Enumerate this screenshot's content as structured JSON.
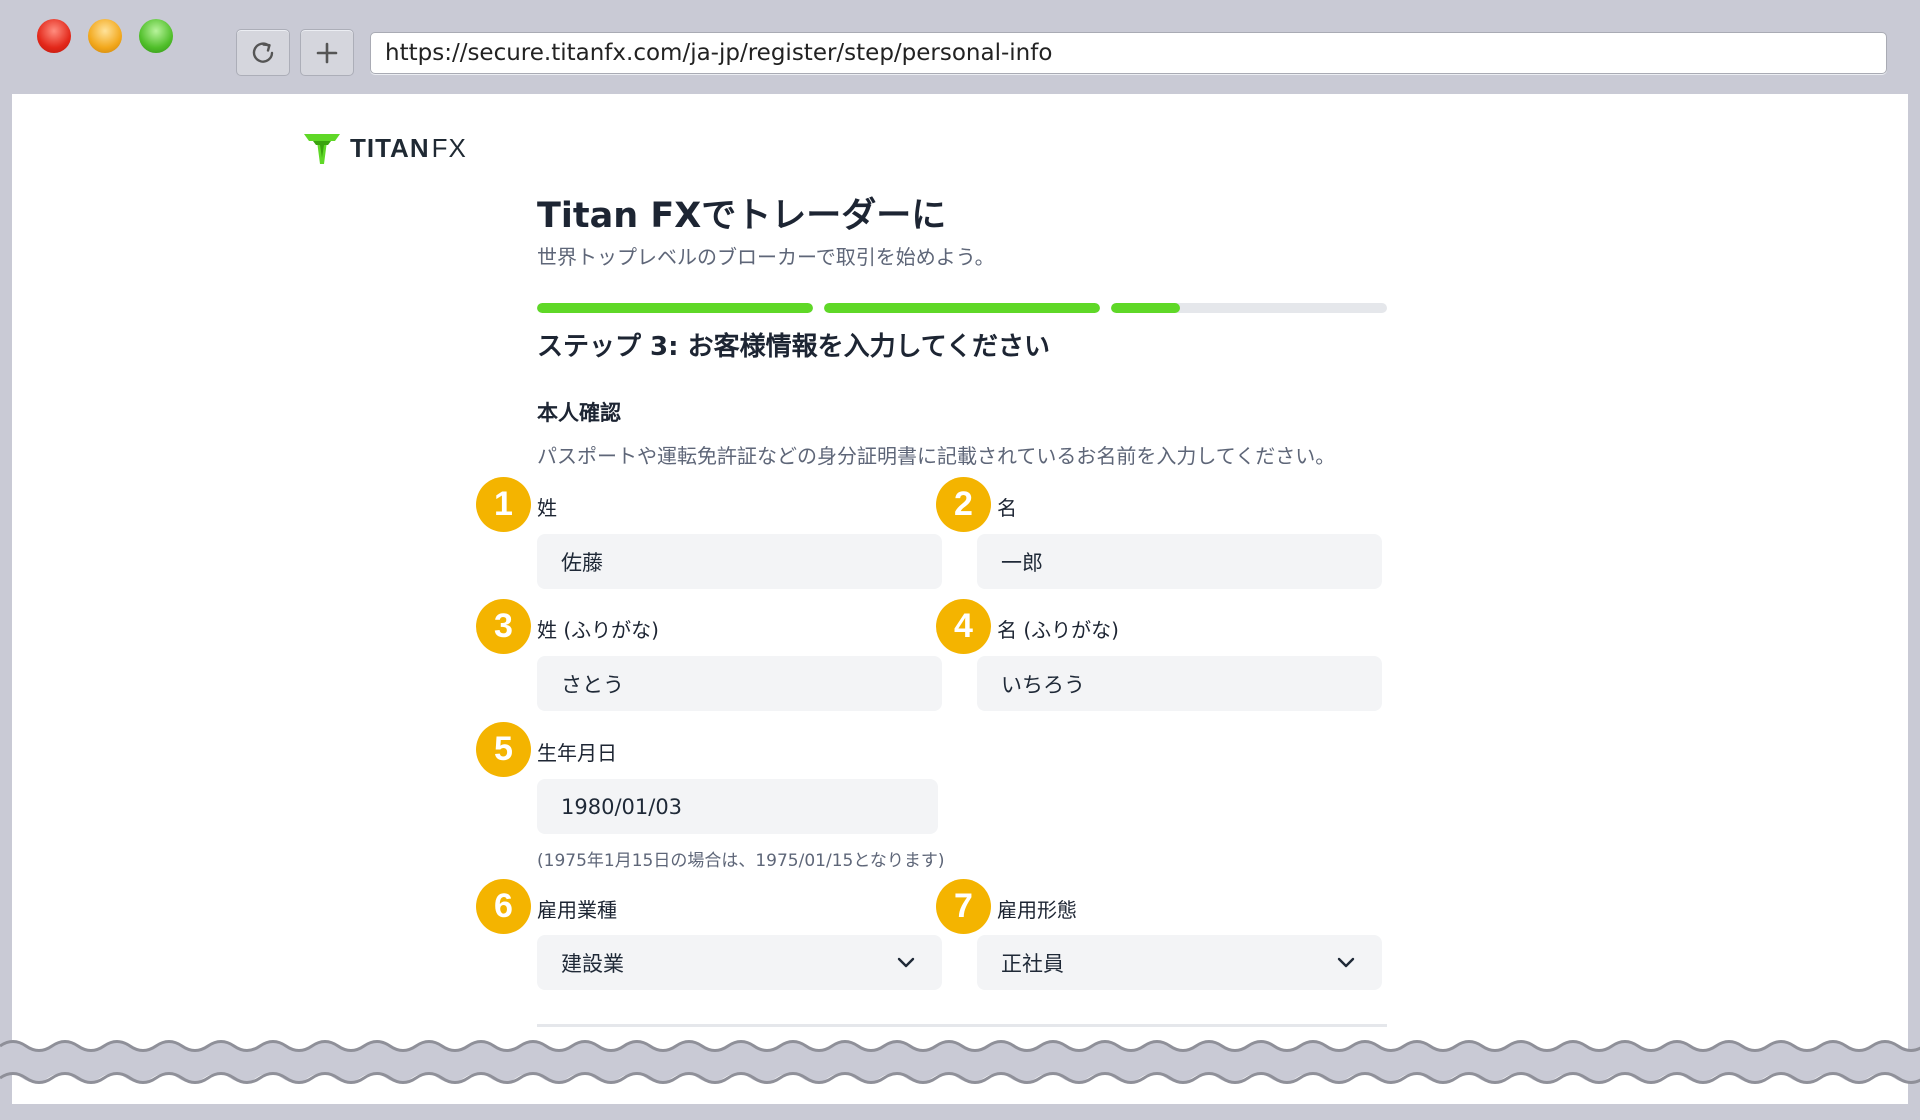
{
  "browser": {
    "url": "https://secure.titanfx.com/ja-jp/register/step/personal-info",
    "reload_icon": "reload-icon",
    "newtab_icon": "plus-icon"
  },
  "brand": {
    "logo_text_1": "TITAN",
    "logo_text_2": "FX",
    "accent": "#5fd827",
    "badge_color": "#f4b400"
  },
  "header": {
    "title": "Titan FXでトレーダーに",
    "subtitle": "世界トップレベルのブローカーで取引を始めよう。"
  },
  "progress": {
    "segments": [
      1,
      1,
      0.25
    ]
  },
  "step_title": "ステップ 3: お客様情報を入力してください",
  "identity": {
    "heading": "本人確認",
    "note": "パスポートや運転免許証などの身分証明書に記載されているお名前を入力してください。"
  },
  "fields": {
    "last_name": {
      "badge": "1",
      "label": "姓",
      "value": "佐藤"
    },
    "first_name": {
      "badge": "2",
      "label": "名",
      "value": "一郎"
    },
    "last_name_kana": {
      "badge": "3",
      "label": "姓 (ふりがな)",
      "value": "さとう"
    },
    "first_name_kana": {
      "badge": "4",
      "label": "名 (ふりがな)",
      "value": "いちろう"
    },
    "birthdate": {
      "badge": "5",
      "label": "生年月日",
      "value": "1980/01/03",
      "hint": "(1975年1月15日の場合は、1975/01/15となります)"
    },
    "industry": {
      "badge": "6",
      "label": "雇用業種",
      "value": "建設業"
    },
    "employment": {
      "badge": "7",
      "label": "雇用形態",
      "value": "正社員"
    }
  }
}
